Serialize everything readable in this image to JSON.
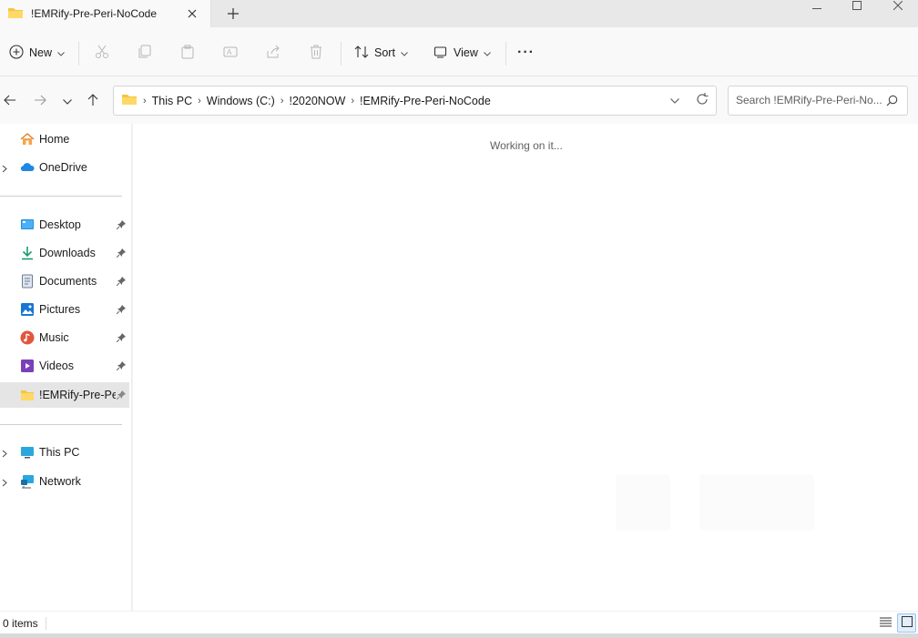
{
  "window": {
    "tab_title": "!EMRify-Pre-Peri-NoCode",
    "icons": [
      "folder-icon",
      "close-icon",
      "plus-icon",
      "minimize-icon",
      "maximize-icon"
    ]
  },
  "commandbar": {
    "new_label": "New",
    "sort_label": "Sort",
    "view_label": "View",
    "more_label": "···"
  },
  "address": {
    "crumbs": [
      "This PC",
      "Windows (C:)",
      "!2020NOW",
      "!EMRify-Pre-Peri-NoCode"
    ],
    "search_placeholder": "Search !EMRify-Pre-Peri-No..."
  },
  "sidebar": {
    "top": [
      {
        "label": "Home",
        "icon": "home-icon"
      },
      {
        "label": "OneDrive",
        "icon": "onedrive-icon"
      }
    ],
    "quick_access": [
      {
        "label": "Desktop",
        "icon": "desktop-icon"
      },
      {
        "label": "Downloads",
        "icon": "download-icon"
      },
      {
        "label": "Documents",
        "icon": "documents-icon"
      },
      {
        "label": "Pictures",
        "icon": "pictures-icon"
      },
      {
        "label": "Music",
        "icon": "music-icon"
      },
      {
        "label": "Videos",
        "icon": "videos-icon"
      },
      {
        "label": "!EMRify-Pre-Peri-NoCode",
        "icon": "folder-icon",
        "selected": true
      }
    ],
    "bottom": [
      {
        "label": "This PC",
        "icon": "pc-icon"
      },
      {
        "label": "Network",
        "icon": "network-icon"
      }
    ]
  },
  "content": {
    "status_message": "Working on it..."
  },
  "statusbar": {
    "item_count": "0 items"
  },
  "colors": {
    "folder_yellow": "#f4c542",
    "accent_blue": "#0f6cbd",
    "selected_bg": "#e5e5e5"
  }
}
